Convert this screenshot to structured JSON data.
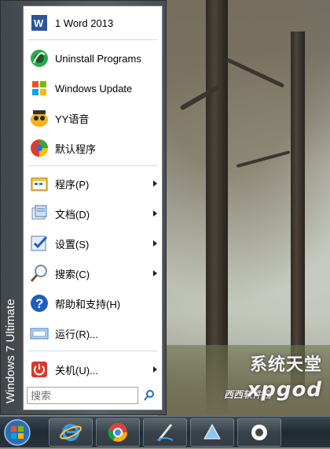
{
  "start_menu": {
    "edition_label": "Windows 7 Ultimate",
    "pinned": [
      {
        "label": "1 Word 2013",
        "icon": "word-icon"
      },
      {
        "label": "Uninstall Programs",
        "icon": "uninstall-icon"
      },
      {
        "label": "Windows Update",
        "icon": "windows-update-icon"
      },
      {
        "label": "YY语音",
        "icon": "yy-icon"
      },
      {
        "label": "默认程序",
        "icon": "default-programs-icon"
      }
    ],
    "classic": [
      {
        "label": "程序(P)",
        "icon": "programs-icon",
        "has_submenu": true
      },
      {
        "label": "文档(D)",
        "icon": "documents-icon",
        "has_submenu": true
      },
      {
        "label": "设置(S)",
        "icon": "settings-icon",
        "has_submenu": true
      },
      {
        "label": "搜索(C)",
        "icon": "search-icon",
        "has_submenu": true
      },
      {
        "label": "帮助和支持(H)",
        "icon": "help-icon",
        "has_submenu": false
      },
      {
        "label": "运行(R)...",
        "icon": "run-icon",
        "has_submenu": false
      }
    ],
    "shutdown": {
      "label": "关机(U)...",
      "icon": "power-icon",
      "has_submenu": true
    },
    "search": {
      "placeholder": "搜索"
    }
  },
  "taskbar": {
    "items": [
      "start-orb",
      "internet-explorer-icon",
      "chrome-icon",
      "paint-tool-icon",
      "app-icon",
      "app-icon-2"
    ]
  },
  "watermark": {
    "top": "系统天堂",
    "bottom": "xpgod",
    "small": "西西软件园"
  },
  "colors": {
    "menu_frame": "#4f555a",
    "taskbar": "#1f2a33",
    "accent_blue": "#1d6fc3"
  }
}
